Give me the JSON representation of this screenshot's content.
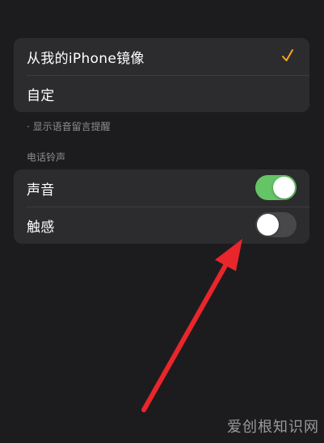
{
  "playback_options": {
    "items": [
      {
        "label": "从我的iPhone镜像",
        "selected": true
      },
      {
        "label": "自定",
        "selected": false
      }
    ],
    "footnote": "· 显示语音留言提醒"
  },
  "ringtone_section": {
    "header": "电话铃声",
    "items": [
      {
        "label": "声音",
        "state": "on"
      },
      {
        "label": "触感",
        "state": "off"
      }
    ]
  },
  "colors": {
    "background": "#1c1c1e",
    "group_background": "#2c2c2e",
    "accent_check": "#f5a623",
    "toggle_on": "#65c466",
    "toggle_off": "#48484a",
    "annotation_arrow": "#e8262b"
  },
  "icons": {
    "selected_mark": "checkmark-icon",
    "annotation": "red-arrow-icon"
  },
  "watermark": "爱创根知识网"
}
